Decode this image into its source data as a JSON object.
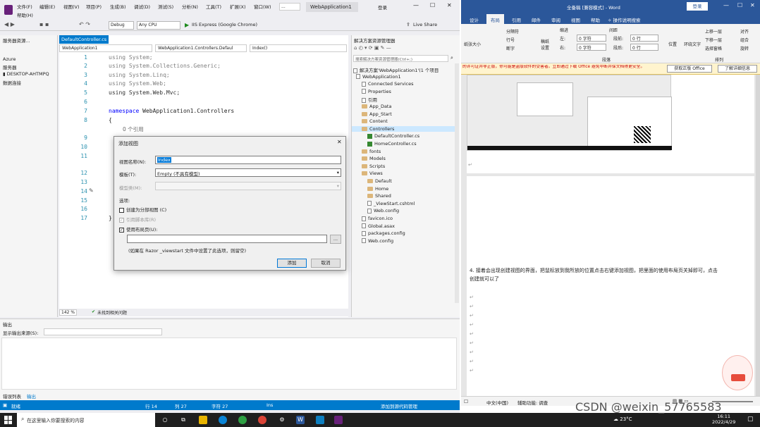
{
  "vs": {
    "title": "WebApplication1",
    "search_placeholder": "...",
    "login": "登录",
    "menu": [
      "文件(F)",
      "编辑(E)",
      "视图(V)",
      "项目(P)",
      "生成(B)",
      "调试(D)",
      "测试(S)",
      "分析(N)",
      "工具(T)",
      "扩展(X)",
      "窗口(W)",
      "帮助(H)"
    ],
    "toolbar": {
      "config": "Debug",
      "platform": "Any CPU",
      "run": "IIS Express (Google Chrome)",
      "live_share": "Live Share"
    },
    "left_panel": {
      "title": "服务器资源...",
      "items": [
        "Azure",
        "服务器",
        "DESKTOP-AHTMPQ",
        "数据连接"
      ]
    },
    "editor": {
      "tab": "DefaultController.cs",
      "nav1": "WebApplication1",
      "nav2": "WebApplication1.Controllers.Defaul",
      "nav3": "Index()",
      "line_numbers": [
        "1",
        "2",
        "3",
        "4",
        "5",
        "6",
        "7",
        "8",
        "",
        "9",
        "10",
        "11",
        "",
        "12",
        "13",
        "14",
        "15",
        "16",
        "17"
      ],
      "lines": {
        "l1": "using System;",
        "l2": "using System.Collections.Generic;",
        "l3": "using System.Linq;",
        "l4": "using System.Web;",
        "l5": "using System.Web.Mvc;",
        "l7a": "namespace ",
        "l7b": "WebApplication1.Controllers",
        "l8": "{",
        "ref": "0 个引用",
        "l17": "}"
      },
      "zoom": "142 %",
      "issues": "未找到相关问题"
    },
    "solution": {
      "title": "解决方案资源管理器",
      "search": "搜索解决方案资源管理器(Ctrl+;)",
      "items": [
        {
          "label": "解决方案'WebApplication1'(1 个项目",
          "kind": "sln"
        },
        {
          "label": "WebApplication1",
          "kind": "proj"
        },
        {
          "label": "Connected Services",
          "kind": "file"
        },
        {
          "label": "Properties",
          "kind": "file"
        },
        {
          "label": "引用",
          "kind": "file"
        },
        {
          "label": "App_Data",
          "kind": "folder"
        },
        {
          "label": "App_Start",
          "kind": "folder"
        },
        {
          "label": "Content",
          "kind": "folder"
        },
        {
          "label": "Controllers",
          "kind": "folder"
        },
        {
          "label": "DefaultController.cs",
          "kind": "cs"
        },
        {
          "label": "HomeController.cs",
          "kind": "cs"
        },
        {
          "label": "fonts",
          "kind": "folder"
        },
        {
          "label": "Models",
          "kind": "folder"
        },
        {
          "label": "Scripts",
          "kind": "folder"
        },
        {
          "label": "Views",
          "kind": "folder"
        },
        {
          "label": "Default",
          "kind": "folder"
        },
        {
          "label": "Home",
          "kind": "folder"
        },
        {
          "label": "Shared",
          "kind": "folder"
        },
        {
          "label": "_ViewStart.cshtml",
          "kind": "file"
        },
        {
          "label": "Web.config",
          "kind": "file"
        },
        {
          "label": "favicon.ico",
          "kind": "file"
        },
        {
          "label": "Global.asax",
          "kind": "file"
        },
        {
          "label": "packages.config",
          "kind": "file"
        },
        {
          "label": "Web.config",
          "kind": "file"
        }
      ]
    },
    "output": {
      "title": "输出",
      "source_label": "显示输出来源(S):",
      "tabs": [
        "错误列表",
        "输出"
      ]
    },
    "status": {
      "ready": "就绪",
      "row": "行 14",
      "col": "列 27",
      "char": "字符 27",
      "ins": "Ins",
      "source_control": "添加到源代码管理"
    },
    "dialog": {
      "title": "添加视图",
      "view_name_label": "视图名称(N):",
      "view_name_value": "Index",
      "template_label": "模板(T):",
      "template_value": "Empty (不具有模型)",
      "model_label": "模型类(M):",
      "options_label": "选项:",
      "partial_label": "创建为分部视图 (C)",
      "script_label": "引用脚本库(R)",
      "layout_label": "使用布局页(U):",
      "hint": "(如果在 Razor _viewstart 文件中设置了此选项，则留空)",
      "browse": "...",
      "add": "添加",
      "cancel": "取消"
    }
  },
  "word": {
    "title": "全备稿 [兼容模式] - Word",
    "login": "登录",
    "tabs": [
      "设计",
      "布局",
      "引用",
      "邮件",
      "审阅",
      "视图",
      "帮助",
      "操作说明搜索"
    ],
    "ribbon": {
      "group1": "分隔符",
      "group1b": "行号",
      "group1c": "断字",
      "indent_label": "缩进",
      "spacing_label": "间距",
      "left": "左:",
      "right": "右:",
      "before": "段前:",
      "after": "段后:",
      "indent_val": "0 字符",
      "spacing_val": "0 行",
      "arrange1": "上移一层",
      "arrange2": "下移一层",
      "arrange3": "选择窗格",
      "arrange4": "对齐",
      "arrange5": "组合",
      "arrange6": "旋转",
      "paragraph": "段落",
      "arrange": "排列",
      "paper": "纸张大小",
      "manuscript": "稿纸设置",
      "position": "位置",
      "wrap": "环绕文字"
    },
    "notice": "的许可证并非正版，你可能是盗版软件的受害者。立即通过下载 Office 避免中断并保文档得更安全。",
    "get_office": "获取正版 Office",
    "learn_more": "了解详细信息",
    "doc_text": "4. 接着会出现创建视图的界面，把鼠标放到我所放的位置点击右键添加视图，把里面的使用布局页关掉即可，点击创建就可以了",
    "status_lang": "中文(中国)",
    "status_access": "辅助功能: 调查"
  },
  "taskbar": {
    "search_placeholder": "在这里输入你要搜索的内容",
    "watermark": "CSDN @weixin_57765583",
    "temp": "23°C",
    "date": "2022/4/29",
    "time": "16:11"
  }
}
